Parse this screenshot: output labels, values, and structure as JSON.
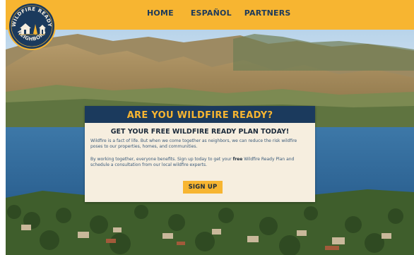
{
  "nav": {
    "home": "HOME",
    "espanol": "ESPAÑOL",
    "partners": "PARTNERS"
  },
  "logo": {
    "top_text": "WILDFIRE READY",
    "bottom_text": "NEIGHBORS"
  },
  "card": {
    "headline": "ARE YOU WILDFIRE READY?",
    "subhead": "GET YOUR FREE WILDFIRE READY PLAN TODAY!",
    "para1": "Wildfire is a fact of life. But when we come together as neighbors, we can reduce the risk wildfire poses to our properties, homes, and communities.",
    "para2_before": "By working together, everyone benefits. Sign up today to get your ",
    "para2_bold": "free",
    "para2_after": " Wildfire Ready Plan and schedule a consultation from our local wildfire experts.",
    "button": "SIGN UP"
  },
  "colors": {
    "accent_yellow": "#f7b531",
    "navy": "#1b3a5d",
    "card_bg": "#f6eedf"
  }
}
